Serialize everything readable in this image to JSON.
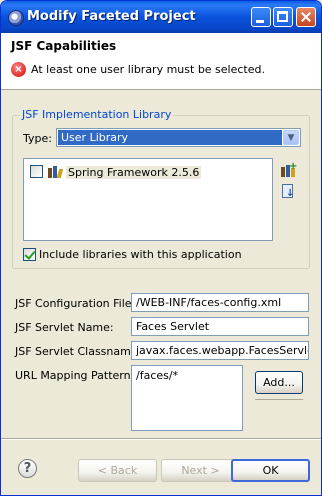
{
  "window": {
    "title": "Modify Faceted Project"
  },
  "header": {
    "title": "JSF Capabilities",
    "message": "At least one user library must be selected."
  },
  "library_group": {
    "label": "JSF Implementation Library",
    "type_label": "Type:",
    "type_value": "User Library",
    "libraries": [
      {
        "label": "Spring Framework 2.5.6",
        "checked": false
      }
    ],
    "include_label": "Include libraries with this application",
    "include_checked": true
  },
  "fields": {
    "config_label": "JSF Configuration File:",
    "config_value": "/WEB-INF/faces-config.xml",
    "servlet_label": "JSF Servlet Name:",
    "servlet_value": "Faces Servlet",
    "classname_label": "JSF Servlet Classname:",
    "classname_value": "javax.faces.webapp.FacesServlet",
    "url_label": "URL Mapping Patterns:",
    "url_patterns": [
      "/faces/*"
    ],
    "add_label": "Add..."
  },
  "footer": {
    "help": "?",
    "back_label": "< Back",
    "next_label": "Next >",
    "ok_label": "OK"
  },
  "colors": {
    "title_bar": "#0a52dc",
    "selection": "#316ac5",
    "group_label": "#0046d5",
    "error": "#d40000"
  }
}
